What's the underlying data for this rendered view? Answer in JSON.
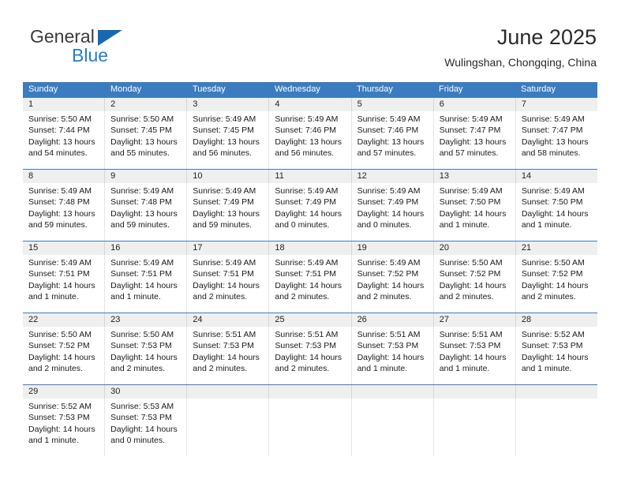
{
  "brand": {
    "name_top": "General",
    "name_bottom": "Blue"
  },
  "header": {
    "title": "June 2025",
    "subtitle": "Wulingshan, Chongqing, China"
  },
  "weekdays": [
    "Sunday",
    "Monday",
    "Tuesday",
    "Wednesday",
    "Thursday",
    "Friday",
    "Saturday"
  ],
  "colors": {
    "header_blue": "#3b7cc0",
    "brand_blue": "#1f7fd1",
    "daynum_background": "#efefef"
  },
  "weeks": [
    [
      {
        "day": "1",
        "sunrise": "Sunrise: 5:50 AM",
        "sunset": "Sunset: 7:44 PM",
        "daylight1": "Daylight: 13 hours",
        "daylight2": "and 54 minutes."
      },
      {
        "day": "2",
        "sunrise": "Sunrise: 5:50 AM",
        "sunset": "Sunset: 7:45 PM",
        "daylight1": "Daylight: 13 hours",
        "daylight2": "and 55 minutes."
      },
      {
        "day": "3",
        "sunrise": "Sunrise: 5:49 AM",
        "sunset": "Sunset: 7:45 PM",
        "daylight1": "Daylight: 13 hours",
        "daylight2": "and 56 minutes."
      },
      {
        "day": "4",
        "sunrise": "Sunrise: 5:49 AM",
        "sunset": "Sunset: 7:46 PM",
        "daylight1": "Daylight: 13 hours",
        "daylight2": "and 56 minutes."
      },
      {
        "day": "5",
        "sunrise": "Sunrise: 5:49 AM",
        "sunset": "Sunset: 7:46 PM",
        "daylight1": "Daylight: 13 hours",
        "daylight2": "and 57 minutes."
      },
      {
        "day": "6",
        "sunrise": "Sunrise: 5:49 AM",
        "sunset": "Sunset: 7:47 PM",
        "daylight1": "Daylight: 13 hours",
        "daylight2": "and 57 minutes."
      },
      {
        "day": "7",
        "sunrise": "Sunrise: 5:49 AM",
        "sunset": "Sunset: 7:47 PM",
        "daylight1": "Daylight: 13 hours",
        "daylight2": "and 58 minutes."
      }
    ],
    [
      {
        "day": "8",
        "sunrise": "Sunrise: 5:49 AM",
        "sunset": "Sunset: 7:48 PM",
        "daylight1": "Daylight: 13 hours",
        "daylight2": "and 59 minutes."
      },
      {
        "day": "9",
        "sunrise": "Sunrise: 5:49 AM",
        "sunset": "Sunset: 7:48 PM",
        "daylight1": "Daylight: 13 hours",
        "daylight2": "and 59 minutes."
      },
      {
        "day": "10",
        "sunrise": "Sunrise: 5:49 AM",
        "sunset": "Sunset: 7:49 PM",
        "daylight1": "Daylight: 13 hours",
        "daylight2": "and 59 minutes."
      },
      {
        "day": "11",
        "sunrise": "Sunrise: 5:49 AM",
        "sunset": "Sunset: 7:49 PM",
        "daylight1": "Daylight: 14 hours",
        "daylight2": "and 0 minutes."
      },
      {
        "day": "12",
        "sunrise": "Sunrise: 5:49 AM",
        "sunset": "Sunset: 7:49 PM",
        "daylight1": "Daylight: 14 hours",
        "daylight2": "and 0 minutes."
      },
      {
        "day": "13",
        "sunrise": "Sunrise: 5:49 AM",
        "sunset": "Sunset: 7:50 PM",
        "daylight1": "Daylight: 14 hours",
        "daylight2": "and 1 minute."
      },
      {
        "day": "14",
        "sunrise": "Sunrise: 5:49 AM",
        "sunset": "Sunset: 7:50 PM",
        "daylight1": "Daylight: 14 hours",
        "daylight2": "and 1 minute."
      }
    ],
    [
      {
        "day": "15",
        "sunrise": "Sunrise: 5:49 AM",
        "sunset": "Sunset: 7:51 PM",
        "daylight1": "Daylight: 14 hours",
        "daylight2": "and 1 minute."
      },
      {
        "day": "16",
        "sunrise": "Sunrise: 5:49 AM",
        "sunset": "Sunset: 7:51 PM",
        "daylight1": "Daylight: 14 hours",
        "daylight2": "and 1 minute."
      },
      {
        "day": "17",
        "sunrise": "Sunrise: 5:49 AM",
        "sunset": "Sunset: 7:51 PM",
        "daylight1": "Daylight: 14 hours",
        "daylight2": "and 2 minutes."
      },
      {
        "day": "18",
        "sunrise": "Sunrise: 5:49 AM",
        "sunset": "Sunset: 7:51 PM",
        "daylight1": "Daylight: 14 hours",
        "daylight2": "and 2 minutes."
      },
      {
        "day": "19",
        "sunrise": "Sunrise: 5:49 AM",
        "sunset": "Sunset: 7:52 PM",
        "daylight1": "Daylight: 14 hours",
        "daylight2": "and 2 minutes."
      },
      {
        "day": "20",
        "sunrise": "Sunrise: 5:50 AM",
        "sunset": "Sunset: 7:52 PM",
        "daylight1": "Daylight: 14 hours",
        "daylight2": "and 2 minutes."
      },
      {
        "day": "21",
        "sunrise": "Sunrise: 5:50 AM",
        "sunset": "Sunset: 7:52 PM",
        "daylight1": "Daylight: 14 hours",
        "daylight2": "and 2 minutes."
      }
    ],
    [
      {
        "day": "22",
        "sunrise": "Sunrise: 5:50 AM",
        "sunset": "Sunset: 7:52 PM",
        "daylight1": "Daylight: 14 hours",
        "daylight2": "and 2 minutes."
      },
      {
        "day": "23",
        "sunrise": "Sunrise: 5:50 AM",
        "sunset": "Sunset: 7:53 PM",
        "daylight1": "Daylight: 14 hours",
        "daylight2": "and 2 minutes."
      },
      {
        "day": "24",
        "sunrise": "Sunrise: 5:51 AM",
        "sunset": "Sunset: 7:53 PM",
        "daylight1": "Daylight: 14 hours",
        "daylight2": "and 2 minutes."
      },
      {
        "day": "25",
        "sunrise": "Sunrise: 5:51 AM",
        "sunset": "Sunset: 7:53 PM",
        "daylight1": "Daylight: 14 hours",
        "daylight2": "and 2 minutes."
      },
      {
        "day": "26",
        "sunrise": "Sunrise: 5:51 AM",
        "sunset": "Sunset: 7:53 PM",
        "daylight1": "Daylight: 14 hours",
        "daylight2": "and 1 minute."
      },
      {
        "day": "27",
        "sunrise": "Sunrise: 5:51 AM",
        "sunset": "Sunset: 7:53 PM",
        "daylight1": "Daylight: 14 hours",
        "daylight2": "and 1 minute."
      },
      {
        "day": "28",
        "sunrise": "Sunrise: 5:52 AM",
        "sunset": "Sunset: 7:53 PM",
        "daylight1": "Daylight: 14 hours",
        "daylight2": "and 1 minute."
      }
    ],
    [
      {
        "day": "29",
        "sunrise": "Sunrise: 5:52 AM",
        "sunset": "Sunset: 7:53 PM",
        "daylight1": "Daylight: 14 hours",
        "daylight2": "and 1 minute."
      },
      {
        "day": "30",
        "sunrise": "Sunrise: 5:53 AM",
        "sunset": "Sunset: 7:53 PM",
        "daylight1": "Daylight: 14 hours",
        "daylight2": "and 0 minutes."
      },
      {
        "day": "",
        "sunrise": "",
        "sunset": "",
        "daylight1": "",
        "daylight2": ""
      },
      {
        "day": "",
        "sunrise": "",
        "sunset": "",
        "daylight1": "",
        "daylight2": ""
      },
      {
        "day": "",
        "sunrise": "",
        "sunset": "",
        "daylight1": "",
        "daylight2": ""
      },
      {
        "day": "",
        "sunrise": "",
        "sunset": "",
        "daylight1": "",
        "daylight2": ""
      },
      {
        "day": "",
        "sunrise": "",
        "sunset": "",
        "daylight1": "",
        "daylight2": ""
      }
    ]
  ]
}
